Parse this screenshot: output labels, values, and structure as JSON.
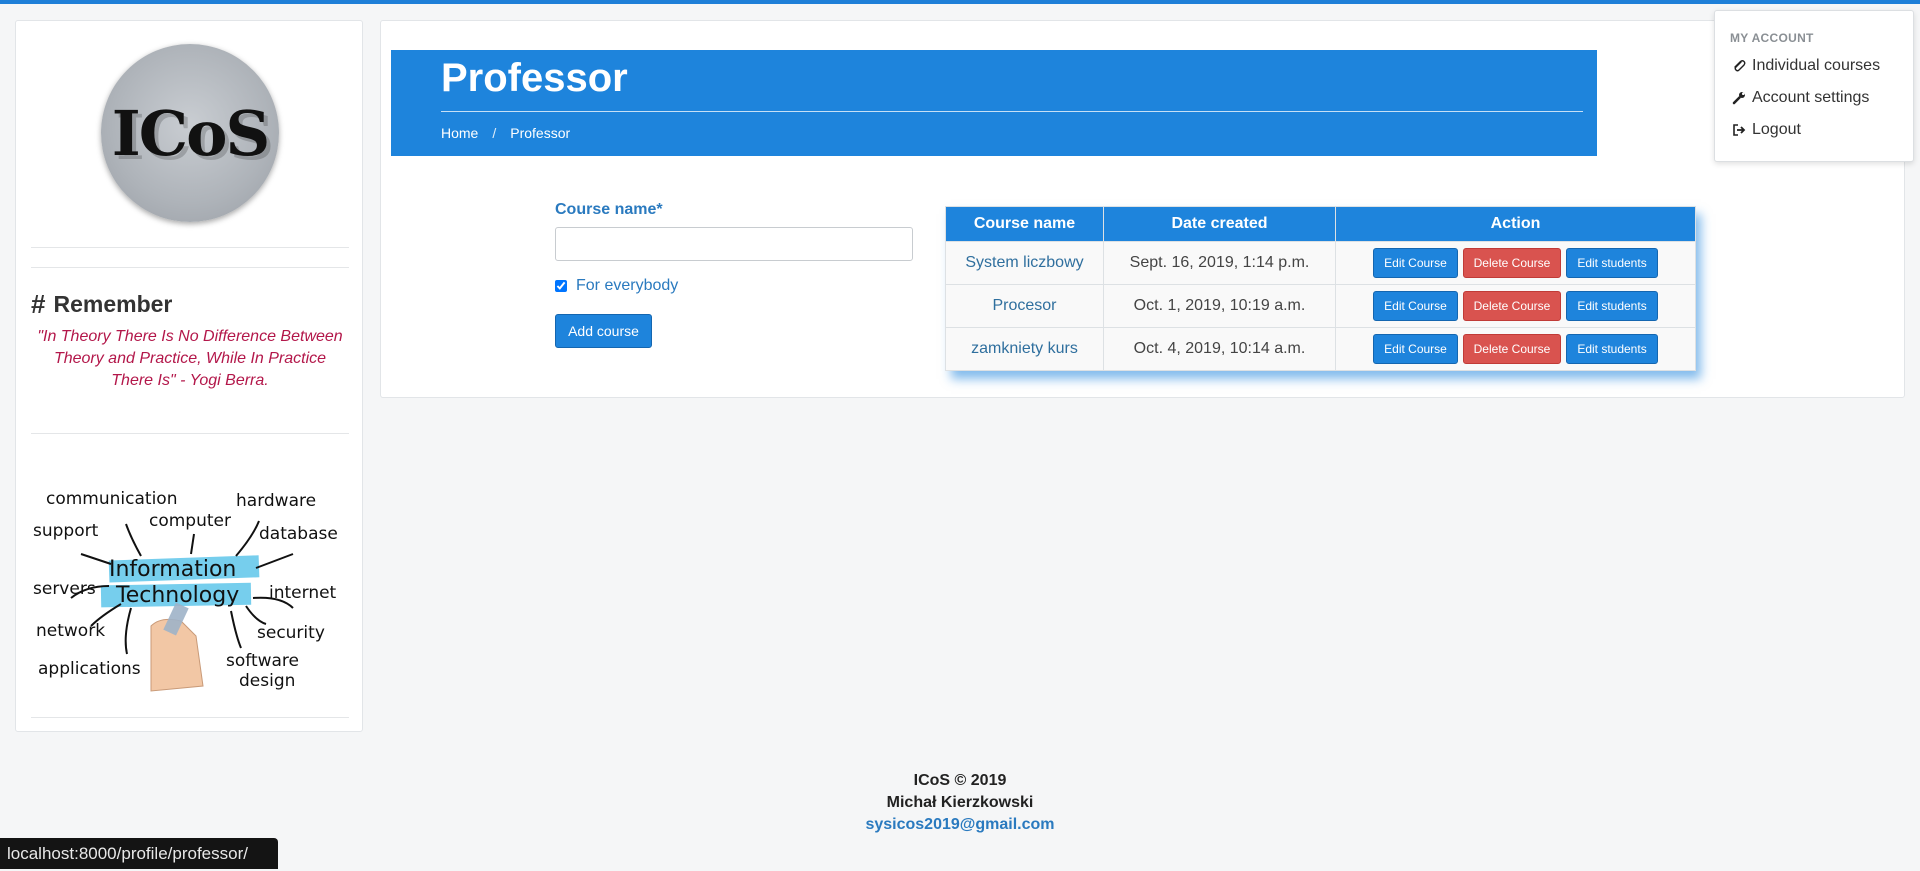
{
  "sidebar": {
    "logo_text": "ICoS",
    "remember_title": "Remember",
    "quote": "\"In Theory There Is No Difference Between Theory and Practice, While In Practice There Is\" - Yogi Berra.",
    "it_image_words": {
      "center_line1": "Information",
      "center_line2": "Technology",
      "w1": "communication",
      "w2": "hardware",
      "w3": "support",
      "w4": "computer",
      "w5": "database",
      "w6": "servers",
      "w7": "internet",
      "w8": "network",
      "w9": "security",
      "w10": "applications",
      "w11": "software",
      "w12": "design"
    }
  },
  "hero": {
    "title": "Professor",
    "breadcrumb_home": "Home",
    "breadcrumb_sep": "/",
    "breadcrumb_current": "Professor"
  },
  "form": {
    "course_name_label": "Course name",
    "required_mark": "*",
    "course_name_value": "",
    "checkbox_label": "For everybody",
    "checkbox_checked": true,
    "submit_label": "Add course"
  },
  "table": {
    "headers": [
      "Course name",
      "Date created",
      "Action"
    ],
    "rows": [
      {
        "name": "System liczbowy",
        "date": "Sept. 16, 2019, 1:14 p.m."
      },
      {
        "name": "Procesor",
        "date": "Oct. 1, 2019, 10:19 a.m."
      },
      {
        "name": "zamkniety kurs",
        "date": "Oct. 4, 2019, 10:14 a.m."
      }
    ],
    "edit_label": "Edit Course",
    "delete_label": "Delete Course",
    "students_label": "Edit students"
  },
  "account_menu": {
    "header": "MY ACCOUNT",
    "items": [
      {
        "label": "Individual courses",
        "icon": "paperclip-icon"
      },
      {
        "label": "Account settings",
        "icon": "wrench-icon"
      },
      {
        "label": "Logout",
        "icon": "logout-icon"
      }
    ]
  },
  "footer": {
    "line1": "ICoS © 2019",
    "line2": "Michał Kierzkowski",
    "email": "sysicos2019@gmail.com"
  },
  "status_url": "localhost:8000/profile/professor/",
  "colors": {
    "accent": "#1e84dc",
    "danger": "#d9534f",
    "quote": "#b3174a",
    "link": "#2a7abf"
  }
}
